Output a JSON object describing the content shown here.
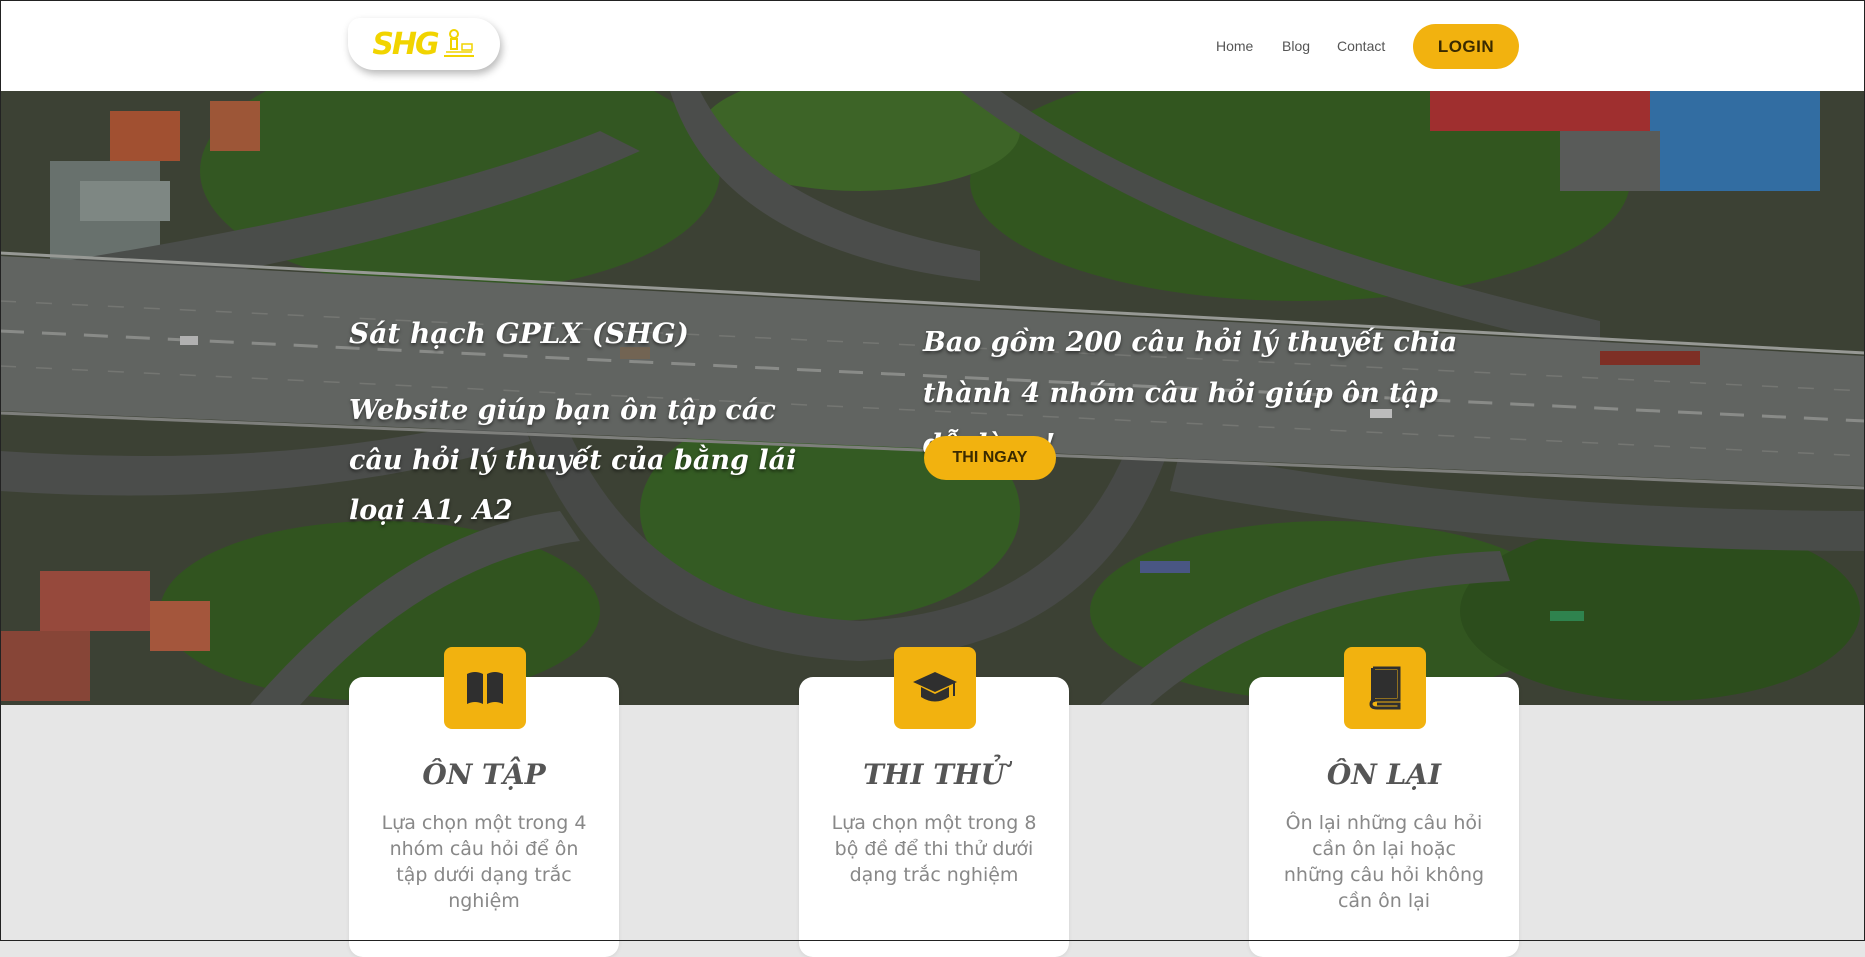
{
  "header": {
    "logo_text": "SHG",
    "nav": [
      "Home",
      "Blog",
      "Contact"
    ],
    "login_label": "LOGIN"
  },
  "hero": {
    "title": "Sát hạch GPLX (SHG)",
    "subtitle": "Website giúp bạn ôn tập các câu hỏi lý thuyết của bằng lái loại A1, A2",
    "right_text": "Bao gồm 200 câu hỏi lý thuyết chia thành 4 nhóm câu hỏi giúp ôn tập dễ dàng!",
    "cta_label": "THI NGAY"
  },
  "cards": [
    {
      "icon": "book-open-icon",
      "title": "ÔN TẬP",
      "desc": "Lựa chọn một trong 4 nhóm câu hỏi để ôn tập dưới dạng trắc nghiệm"
    },
    {
      "icon": "graduation-cap-icon",
      "title": "THI THỬ",
      "desc": "Lựa chọn một trong 8 bộ đề để thi thử dưới dạng trắc nghiệm"
    },
    {
      "icon": "book-icon",
      "title": "ÔN LẠI",
      "desc": "Ôn lại những câu hỏi cần ôn lại hoặc những câu hỏi không cần ôn lại"
    }
  ],
  "colors": {
    "accent": "#f2b20f",
    "logo": "#f1d400",
    "muted_bg": "#e6e6e6"
  }
}
